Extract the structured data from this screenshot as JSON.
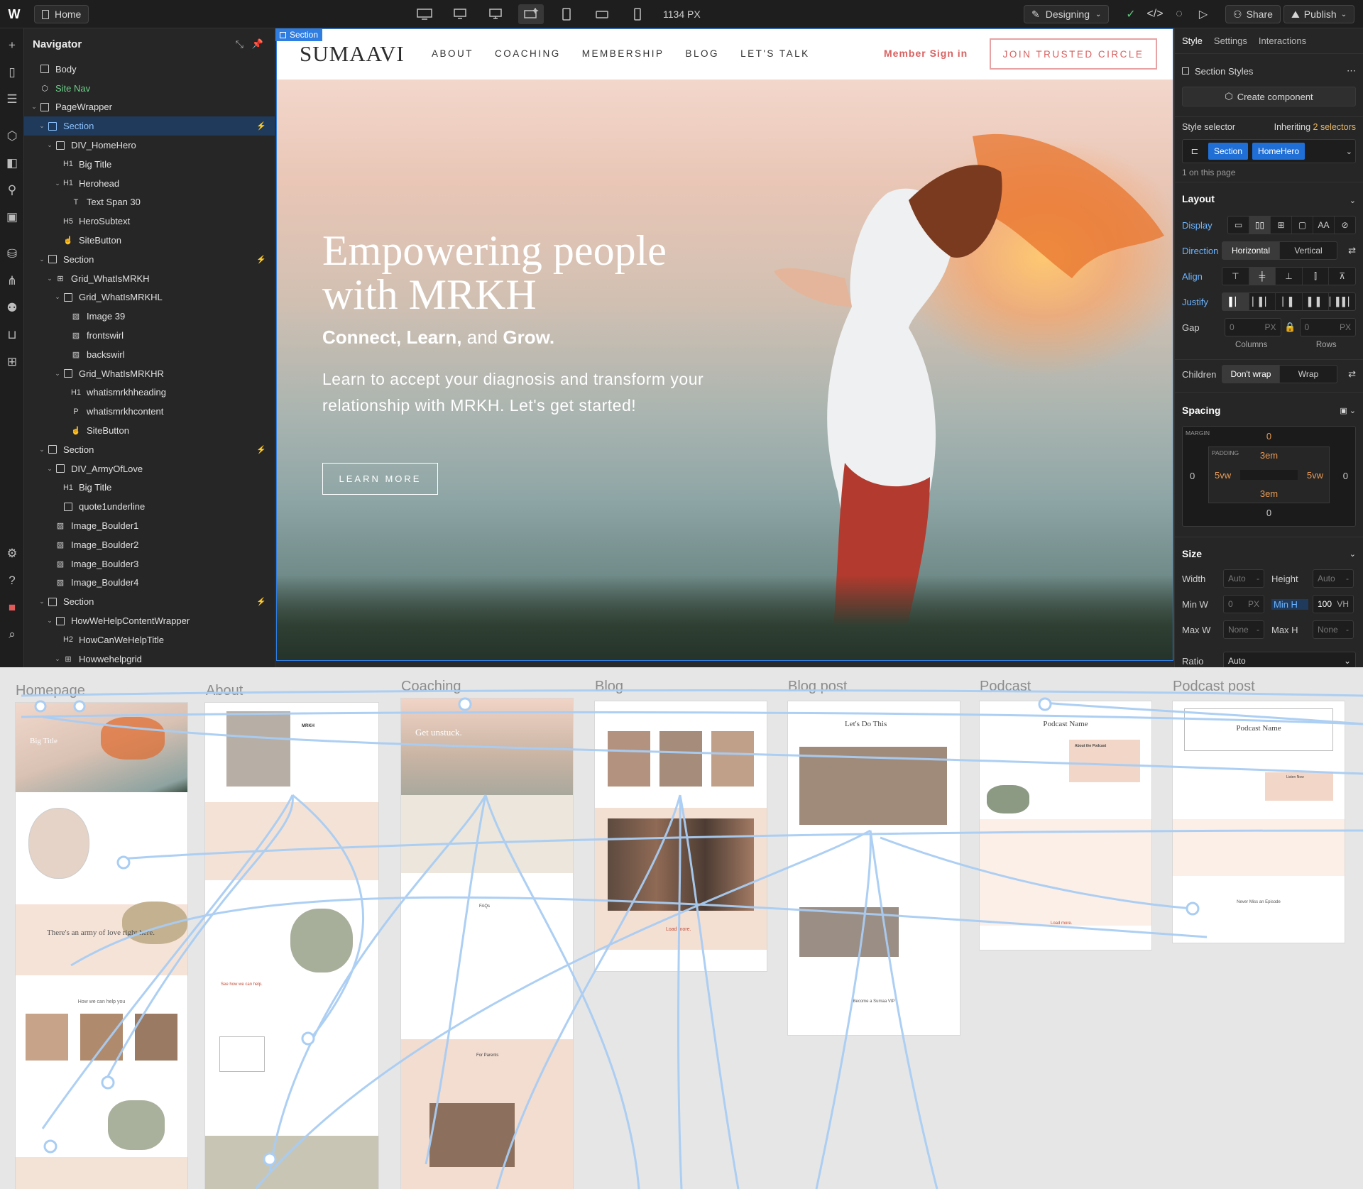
{
  "topbar": {
    "page_label": "Home",
    "width_readout": "1134 PX",
    "mode_label": "Designing",
    "share_label": "Share",
    "publish_label": "Publish"
  },
  "navigator": {
    "title": "Navigator",
    "items": [
      {
        "label": "Body",
        "icon": "box-icon"
      },
      {
        "label": "Site Nav",
        "icon": "component-icon"
      },
      {
        "label": "PageWrapper",
        "icon": "box-icon"
      },
      {
        "label": "Section",
        "icon": "section-icon"
      },
      {
        "label": "DIV_HomeHero",
        "icon": "box-icon"
      },
      {
        "label": "Big Title",
        "tag": "H1"
      },
      {
        "label": "Herohead",
        "tag": "H1"
      },
      {
        "label": "Text Span 30",
        "tag": "T"
      },
      {
        "label": "HeroSubtext",
        "tag": "H5"
      },
      {
        "label": "SiteButton",
        "icon": "link-icon"
      },
      {
        "label": "Section",
        "icon": "section-icon"
      },
      {
        "label": "Grid_WhatIsMRKH",
        "icon": "grid-icon"
      },
      {
        "label": "Grid_WhatIsMRKHL",
        "icon": "box-icon"
      },
      {
        "label": "Image 39",
        "icon": "image-icon"
      },
      {
        "label": "frontswirl",
        "icon": "image-icon"
      },
      {
        "label": "backswirl",
        "icon": "image-icon"
      },
      {
        "label": "Grid_WhatIsMRKHR",
        "icon": "box-icon"
      },
      {
        "label": "whatismrkhheading",
        "tag": "H1"
      },
      {
        "label": "whatismrkhcontent",
        "tag": "P"
      },
      {
        "label": "SiteButton",
        "icon": "link-icon"
      },
      {
        "label": "Section",
        "icon": "section-icon"
      },
      {
        "label": "DIV_ArmyOfLove",
        "icon": "box-icon"
      },
      {
        "label": "Big Title",
        "tag": "H1"
      },
      {
        "label": "quote1underline",
        "icon": "box-icon"
      },
      {
        "label": "Image_Boulder1",
        "icon": "image-icon"
      },
      {
        "label": "Image_Boulder2",
        "icon": "image-icon"
      },
      {
        "label": "Image_Boulder3",
        "icon": "image-icon"
      },
      {
        "label": "Image_Boulder4",
        "icon": "image-icon"
      },
      {
        "label": "Section",
        "icon": "section-icon"
      },
      {
        "label": "HowWeHelpContentWrapper",
        "icon": "box-icon"
      },
      {
        "label": "HowCanWeHelpTitle",
        "tag": "H2"
      },
      {
        "label": "Howwehelpgrid",
        "icon": "grid-icon"
      }
    ]
  },
  "canvas": {
    "selection_tag": "Section",
    "site": {
      "brand": "SUMAAVI",
      "menu": [
        "ABOUT",
        "COACHING",
        "MEMBERSHIP",
        "BLOG",
        "LET'S TALK"
      ],
      "signin": "Member Sign in",
      "join": "JOIN TRUSTED CIRCLE",
      "hero_title": "Empowering people with MRKH",
      "hero_sub_connect": "Connect,",
      "hero_sub_learn": "Learn,",
      "hero_sub_and": "and",
      "hero_sub_grow": "Grow.",
      "hero_para": "Learn to accept your diagnosis and transform your relationship with MRKH. Let's get started!",
      "hero_button": "LEARN MORE"
    }
  },
  "style_panel": {
    "tabs": [
      "Style",
      "Settings",
      "Interactions"
    ],
    "section_styles": "Section Styles",
    "create_component": "Create component",
    "style_selector": "Style selector",
    "inheriting": "Inheriting",
    "inheriting_count": "2 selectors",
    "chips": [
      "Section",
      "HomeHero"
    ],
    "on_page": "1 on this page",
    "layout": "Layout",
    "display": "Display",
    "direction": "Direction",
    "direction_options": [
      "Horizontal",
      "Vertical"
    ],
    "align": "Align",
    "justify": "Justify",
    "gap": "Gap",
    "gap_columns": "0",
    "gap_rows": "0",
    "gap_unit": "PX",
    "columns": "Columns",
    "rows": "Rows",
    "children": "Children",
    "children_options": [
      "Don't wrap",
      "Wrap"
    ],
    "spacing": "Spacing",
    "margin_label": "MARGIN",
    "padding_label": "PADDING",
    "margin_top": "0",
    "margin_left": "0",
    "margin_right": "0",
    "margin_bottom": "0",
    "padding_top": "3em",
    "padding_bottom": "3em",
    "padding_left": "5vw",
    "padding_right": "5vw",
    "size": "Size",
    "width": "Width",
    "height": "Height",
    "auto": "Auto",
    "min_w": "Min W",
    "min_h": "Min H",
    "min_w_val": "0",
    "min_h_val": "100",
    "px": "PX",
    "vh": "VH",
    "max_w": "Max W",
    "max_h": "Max H",
    "none": "None",
    "ratio": "Ratio",
    "ratio_val": "Auto",
    "accent": "#2f7de1"
  },
  "board": {
    "frames": [
      "Homepage",
      "About",
      "Coaching",
      "Blog",
      "Blog post",
      "Podcast",
      "Podcast post"
    ],
    "home_big_title": "Big Title",
    "home_army": "There's an army of love right here.",
    "home_help": "How we can help you",
    "about_mrkh": "MRKH",
    "about_link": "See how we can help.",
    "coach_title": "Get unstuck.",
    "coach_faq": "FAQs",
    "coach_parents": "For Parents",
    "blog_load": "Load more.",
    "post_title": "Let's Do This",
    "post_vip": "Become a Sumaa VIP",
    "podcast_name": "Podcast Name",
    "podcast_about": "About the Podcast",
    "podcast_load": "Load more.",
    "ppost_name": "Podcast Name",
    "ppost_listen": "Listen Now",
    "ppost_never": "Never Miss an Episode"
  }
}
